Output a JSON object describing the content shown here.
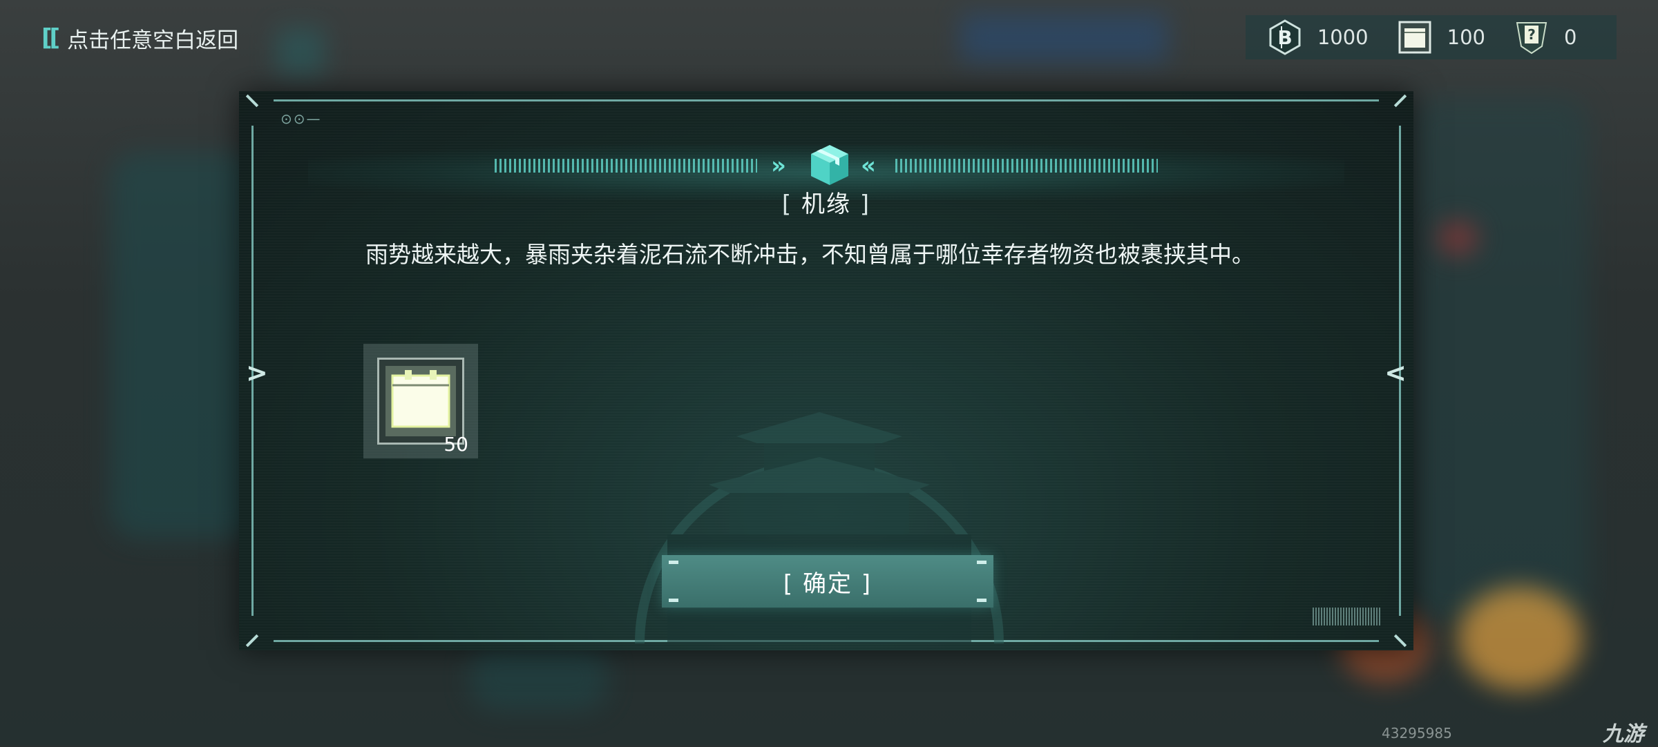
{
  "top_bar": {
    "back_hint": "点击任意空白返回",
    "resources": [
      {
        "icon": "coin-b-icon",
        "value": "1000"
      },
      {
        "icon": "supply-crate-icon",
        "value": "100"
      },
      {
        "icon": "question-card-icon",
        "value": "0"
      }
    ]
  },
  "dialog": {
    "title": "机缘",
    "story": "雨势越来越大，暴雨夹杂着泥石流不断冲击，不知曾属于哪位幸存者物资也被裹挟其中。",
    "reward": {
      "icon": "supply-crate-icon",
      "count": "50"
    },
    "confirm_label": "确定"
  },
  "watermark": {
    "id": "43295985",
    "logo": "九游"
  },
  "colors": {
    "accent": "#5fcfc4",
    "dialog_bg": "#152825",
    "button": "#4f8c86"
  }
}
